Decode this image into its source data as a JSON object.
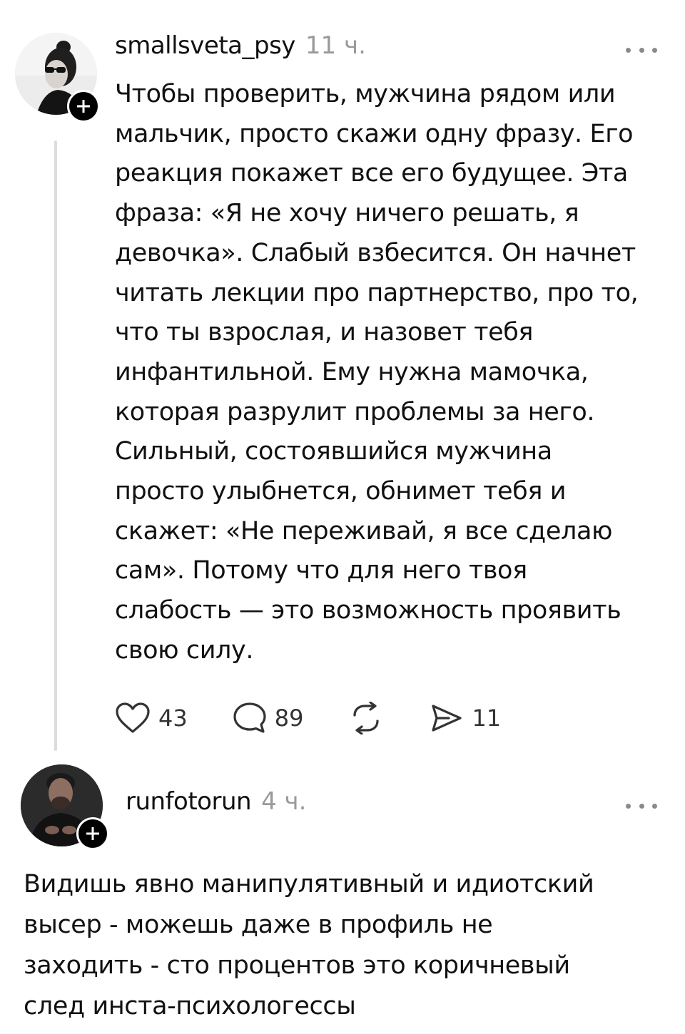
{
  "posts": [
    {
      "username": "smallsveta_psy",
      "time": "11 ч.",
      "text": "Чтобы проверить, мужчина рядом или\nмальчик, просто скажи одну фразу. Его\nреакция покажет все его будущее. Эта\nфраза: «Я не хочу ничего решать, я\nдевочка». Слабый взбесится. Он начнет\nчитать лекции про партнерство, про то,\nчто ты взрослая, и назовет тебя\nинфантильной. Ему нужна мамочка,\nкоторая разрулит проблемы за него.\nСильный, состоявшийся мужчина\nпросто улыбнется, обнимет тебя и\nскажет: «Не переживай, я все сделаю\nсам». Потому что для него твоя\nслабость — это возможность проявить\nсвою силу.",
      "actions": {
        "likes": "43",
        "comments": "89",
        "shares": "11"
      },
      "icons": {
        "like": "heart-icon",
        "comment": "comment-bubble-icon",
        "repost": "repost-icon",
        "share": "send-icon",
        "follow": "plus-icon",
        "more": "more-dots-icon"
      }
    },
    {
      "username": "runfotorun",
      "time": "4 ч.",
      "text": "Видишь явно манипулятивный и идиотский\nвысер - можешь даже в профиль не\nзаходить - сто процентов это коричневый\nслед инста-психологессы",
      "icons": {
        "follow": "plus-icon",
        "more": "more-dots-icon"
      }
    }
  ],
  "colors": {
    "text": "#111111",
    "muted": "#9a9a9a",
    "thread_line": "#dcdcdc",
    "badge": "#000000"
  }
}
